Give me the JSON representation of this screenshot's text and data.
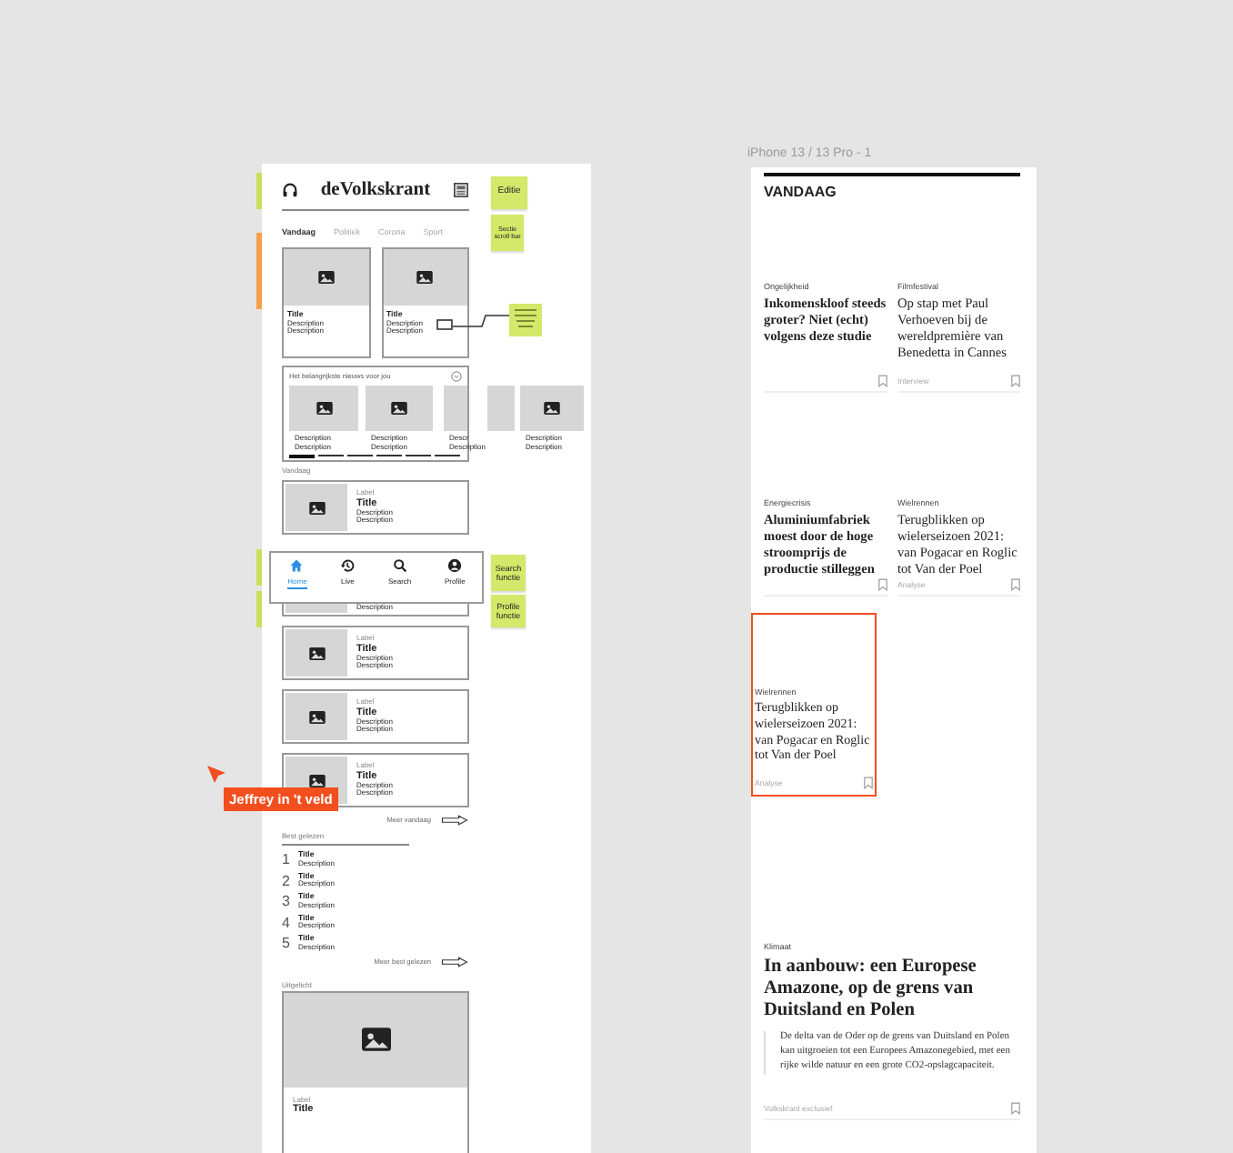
{
  "wireframe": {
    "logo": "deVolkskrant",
    "tabs": [
      {
        "label": "Vandaag",
        "selected": true
      },
      {
        "label": "Politiek",
        "selected": false
      },
      {
        "label": "Corona",
        "selected": false
      },
      {
        "label": "Sport",
        "selected": false
      }
    ],
    "top_cards": [
      {
        "title": "Title",
        "lines": [
          "Description",
          "Description"
        ]
      },
      {
        "title": "Title",
        "lines": [
          "Description",
          "Description"
        ]
      }
    ],
    "carousel": {
      "title": "Het belangrijkste nieuws voor jou",
      "items": [
        {
          "kind": "card",
          "lines": [
            "Description",
            "Description"
          ]
        },
        {
          "kind": "card",
          "lines": [
            "Description",
            "Description"
          ]
        },
        {
          "kind": "card",
          "lines": [
            "Descr",
            "Description"
          ]
        },
        {
          "kind": "image"
        },
        {
          "kind": "card",
          "lines": [
            "Description",
            "Description"
          ]
        }
      ],
      "indicator": [
        {
          "selected": true
        },
        {
          "selected": false
        },
        {
          "selected": false
        },
        {
          "selected": false
        },
        {
          "selected": false
        },
        {
          "selected": false
        }
      ]
    },
    "section": "Vandaag",
    "list_cards": [
      {
        "label": "Label",
        "title": "Title",
        "lines": [
          "Description",
          "Description"
        ]
      },
      {
        "lines": [
          "Description"
        ]
      },
      {
        "label": "Label",
        "title": "Title",
        "lines": [
          "Description",
          "Description"
        ]
      },
      {
        "label": "Label",
        "title": "Title",
        "lines": [
          "Description",
          "Description"
        ]
      },
      {
        "label": "Label",
        "title": "Title",
        "lines": [
          "Description",
          "Description"
        ]
      }
    ],
    "nav": [
      {
        "label": "Home",
        "selected": true
      },
      {
        "label": "Live",
        "selected": false
      },
      {
        "label": "Search",
        "selected": false
      },
      {
        "label": "Profile",
        "selected": false
      }
    ],
    "more_link": "Meer vandaag",
    "best_read": {
      "heading": "Best gelezen",
      "rows": [
        {
          "rank": "1",
          "title": "Title",
          "description": "Description"
        },
        {
          "rank": "2",
          "title": "Title",
          "description": "Description"
        },
        {
          "rank": "3",
          "title": "Title",
          "description": "Description"
        },
        {
          "rank": "4",
          "title": "Title",
          "description": "Description"
        },
        {
          "rank": "5",
          "title": "Title",
          "description": "Description"
        }
      ],
      "more_link": "Meer best gelezen"
    },
    "featured": {
      "heading": "Uitgelicht",
      "label": "Label",
      "title": "Title"
    }
  },
  "stickies": [
    {
      "text": "Editie"
    },
    {
      "text": "Sectie scroll bar"
    },
    {
      "text": "Search functie"
    },
    {
      "text": "Profile functie"
    }
  ],
  "side_markers": [
    {
      "color": "#c8e05a"
    },
    {
      "color": "#f5a04a"
    },
    {
      "color": "#c8e05a"
    },
    {
      "color": "#c8e05a"
    }
  ],
  "cursor": {
    "name": "Jeffrey in 't veld"
  },
  "phone": {
    "frame_title": "iPhone 13 / 13 Pro - 1",
    "heading": "VANDAAG",
    "articles": [
      {
        "label": "Ongelijkheid",
        "headline": "Inkomenskloof steeds groter? Niet (echt) volgens deze studie",
        "bold": true
      },
      {
        "label": "Filmfestival",
        "headline": "Op stap met Paul Verhoeven bij de wereldpremière van Benedetta in Cannes",
        "bold": false,
        "tag": "Interview"
      },
      {
        "label": "Energiecrisis",
        "headline": "Aluminiumfabriek moest door de hoge stroomprijs de productie stilleggen",
        "bold": true
      },
      {
        "label": "Wielrennen",
        "headline": "Terugblikken op wielerseizoen 2021: van Pogacar en Roglic tot Van der Poel",
        "bold": false,
        "tag": "Analyse"
      }
    ],
    "dragged_card": {
      "label": "Wielrennen",
      "headline": "Terugblikken op wielerseizoen 2021: van Pogacar en Roglic tot Van der Poel",
      "tag": "Analyse"
    },
    "feature": {
      "label": "Klimaat",
      "headline": "In aanbouw: een Europese Amazone, op de grens van Duitsland en Polen",
      "intro": "De delta van de Oder op de grens van Duitsland en Polen kan uitgroeien tot een Europees Amazonegebied, met een rijke wilde natuur en een grote CO2-opslagcapaciteit.",
      "tag": "Volkskrant exclusief"
    }
  }
}
